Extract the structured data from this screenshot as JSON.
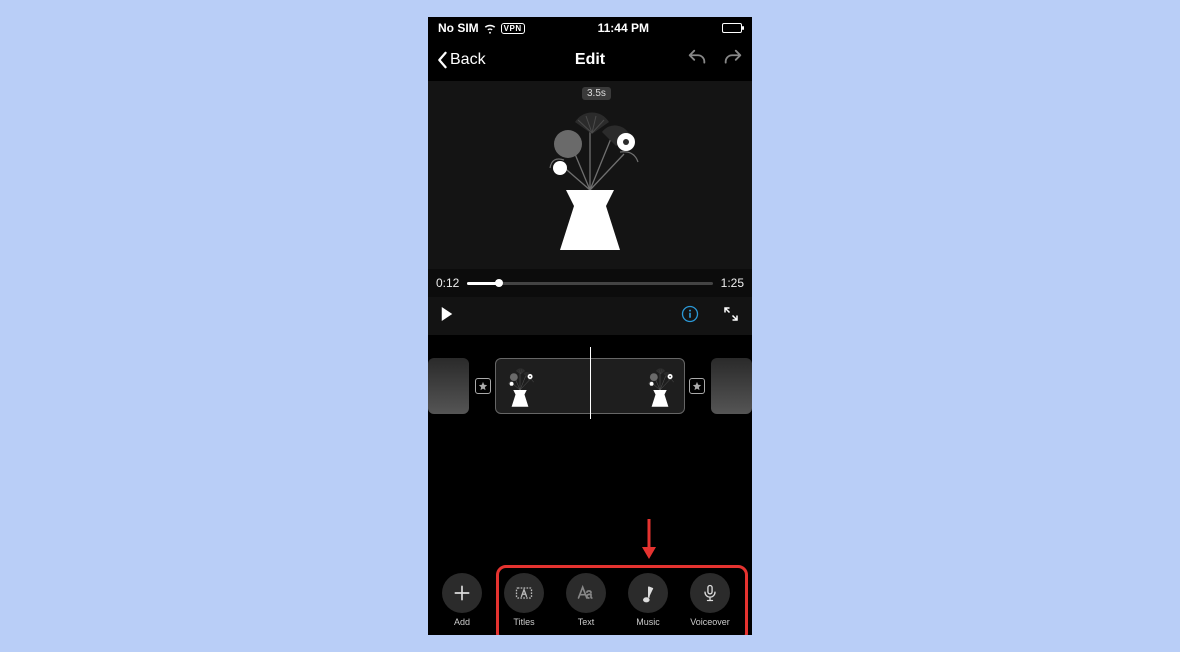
{
  "statusbar": {
    "sim": "No SIM",
    "vpn": "VPN",
    "time": "11:44 PM"
  },
  "nav": {
    "back": "Back",
    "title": "Edit"
  },
  "preview": {
    "duration_chip": "3.5s"
  },
  "scrub": {
    "current": "0:12",
    "total": "1:25",
    "progress_percent": 13
  },
  "tools": [
    {
      "id": "add",
      "label": "Add",
      "icon": "plus-icon"
    },
    {
      "id": "titles",
      "label": "Titles",
      "icon": "titles-icon"
    },
    {
      "id": "text",
      "label": "Text",
      "icon": "text-aa-icon"
    },
    {
      "id": "music",
      "label": "Music",
      "icon": "music-note-icon"
    },
    {
      "id": "voiceover",
      "label": "Voiceover",
      "icon": "microphone-icon"
    }
  ],
  "colors": {
    "page_bg": "#b9cef7",
    "accent_info": "#2b98d6",
    "annotation": "#e53330"
  }
}
